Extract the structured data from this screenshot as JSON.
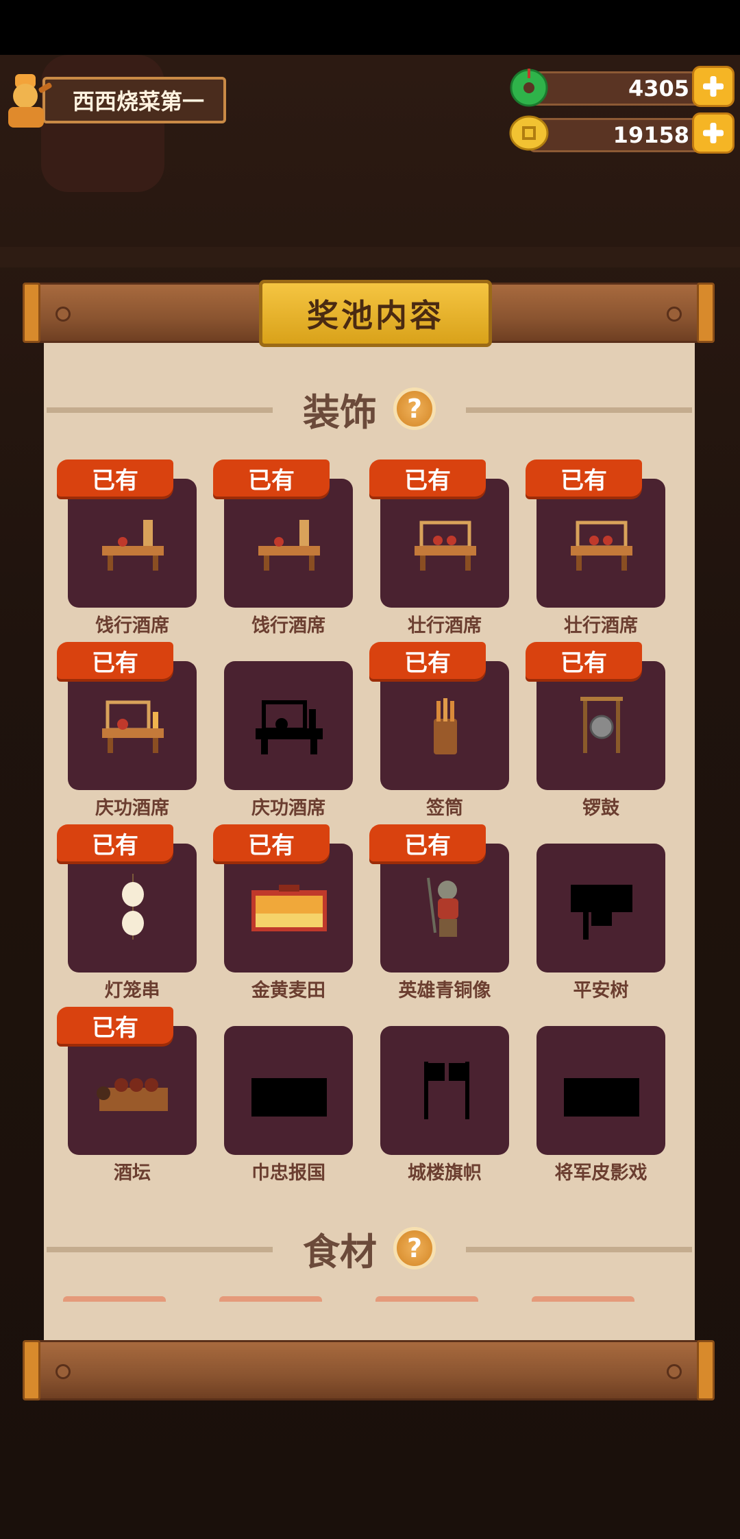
{
  "player": {
    "name": "西西烧菜第一"
  },
  "currency": {
    "jade": "4305",
    "coins": "19158"
  },
  "panel": {
    "title": "奖池内容"
  },
  "sections": {
    "decor": {
      "title": "装饰",
      "help": "?"
    },
    "ingredients": {
      "title": "食材",
      "help": "?"
    }
  },
  "owned_label": "已有",
  "items": [
    {
      "name": "饯行酒席",
      "owned": true
    },
    {
      "name": "饯行酒席",
      "owned": true
    },
    {
      "name": "壮行酒席",
      "owned": true
    },
    {
      "name": "壮行酒席",
      "owned": true
    },
    {
      "name": "庆功酒席",
      "owned": true
    },
    {
      "name": "庆功酒席",
      "owned": false
    },
    {
      "name": "签筒",
      "owned": true
    },
    {
      "name": "锣鼓",
      "owned": true
    },
    {
      "name": "灯笼串",
      "owned": true
    },
    {
      "name": "金黄麦田",
      "owned": true
    },
    {
      "name": "英雄青铜像",
      "owned": true
    },
    {
      "name": "平安树",
      "owned": false
    },
    {
      "name": "酒坛",
      "owned": true
    },
    {
      "name": "巾忠报国",
      "owned": false
    },
    {
      "name": "城楼旗帜",
      "owned": false
    },
    {
      "name": "将军皮影戏",
      "owned": false
    }
  ],
  "colors": {
    "tag": "#d9420f",
    "tile": "#4a2230",
    "paper": "#e3cfb5",
    "gold": "#f5c542"
  }
}
